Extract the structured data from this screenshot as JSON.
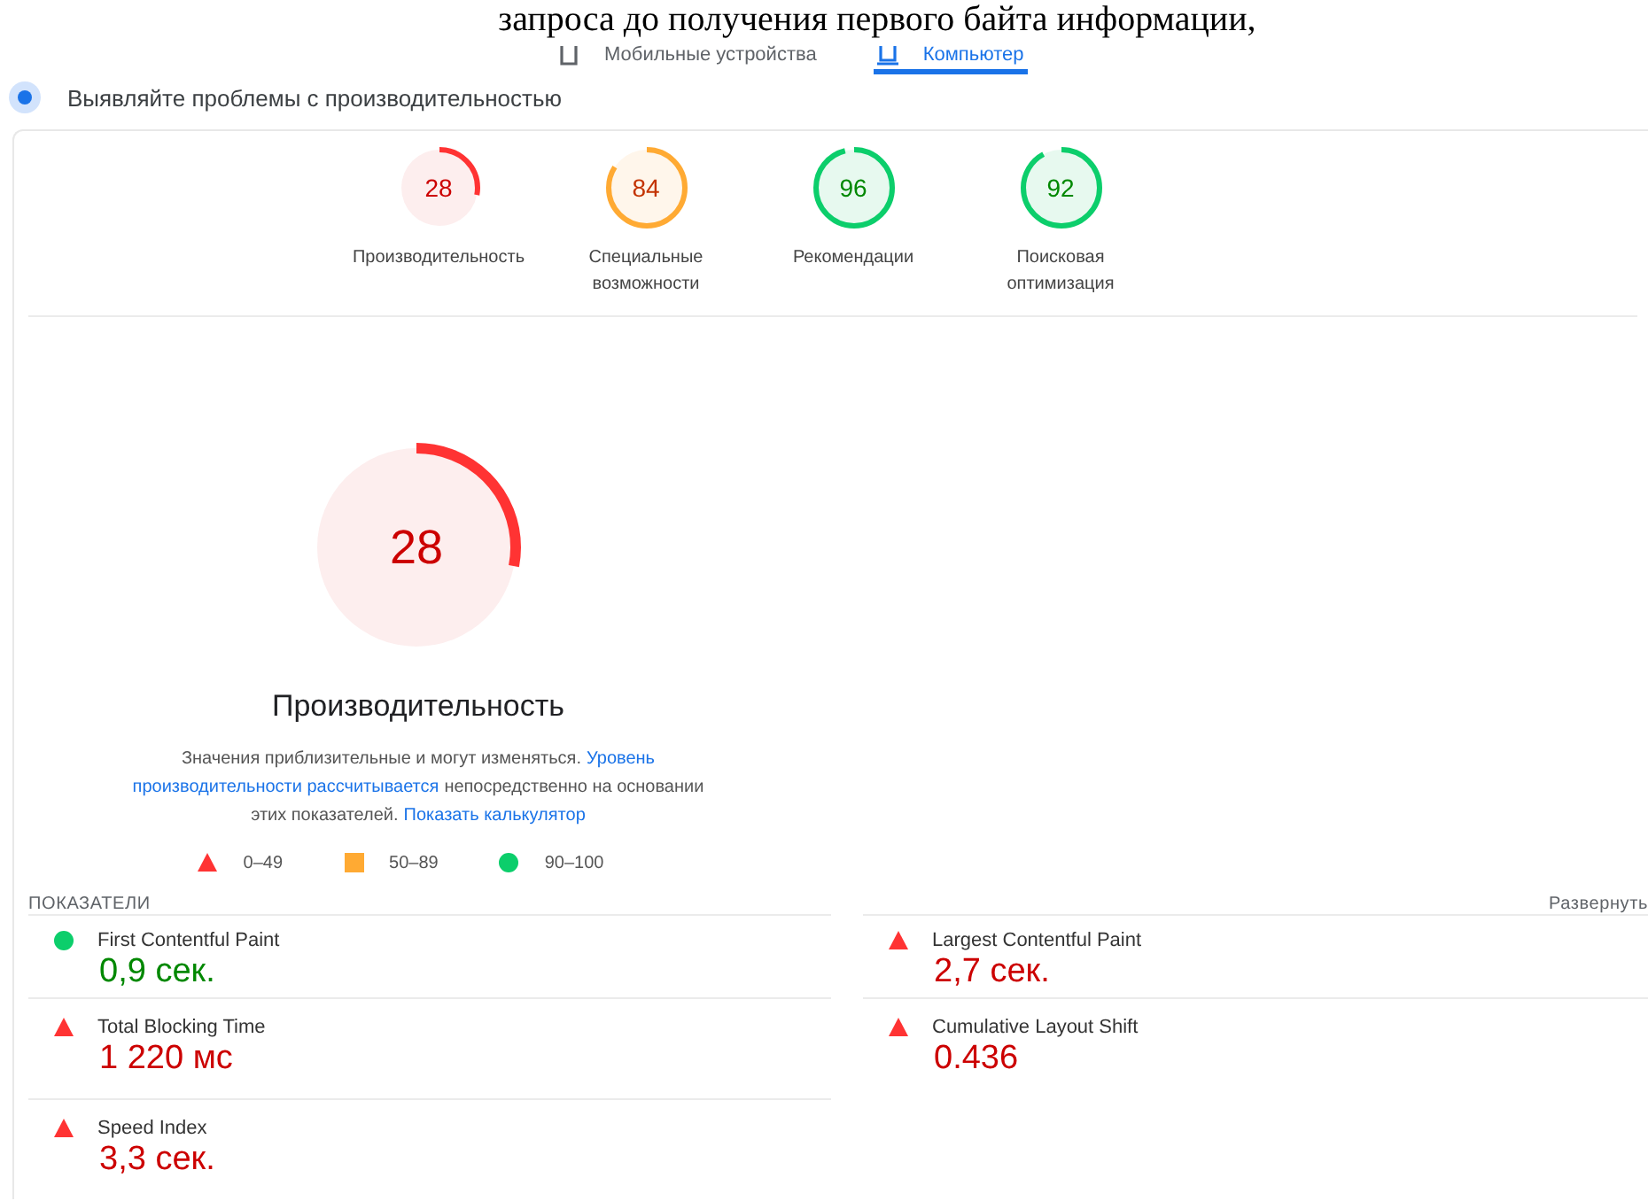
{
  "document_line": "запроса до получения первого байта информации,",
  "tabs": [
    {
      "label": "Мобильные устройства",
      "selected": false
    },
    {
      "label": "Компьютер",
      "selected": true
    }
  ],
  "notice": "Выявляйте проблемы с производительностью",
  "categories": [
    {
      "score": "28",
      "level": 0.28,
      "kind": "fail",
      "label": "Производительность"
    },
    {
      "score": "84",
      "level": 0.84,
      "kind": "average",
      "label": "Специальные возможности"
    },
    {
      "score": "96",
      "level": 0.96,
      "kind": "pass",
      "label": "Рекомендации"
    },
    {
      "score": "92",
      "level": 0.92,
      "kind": "pass",
      "label": "Поисковая оптимизация"
    }
  ],
  "main_score": {
    "score": "28",
    "level": 0.28,
    "kind": "fail",
    "title": "Производительность"
  },
  "description": [
    [
      {
        "kind": "text",
        "text": "Значения приблизительные и могут изменяться."
      },
      {
        "kind": "link",
        "text": "Уровень"
      }
    ],
    [
      {
        "kind": "link",
        "text": "производительности рассчитывается"
      },
      {
        "kind": "text",
        "text": "непосредственно на основании"
      }
    ],
    [
      {
        "kind": "text",
        "text": "этих показателей."
      },
      {
        "kind": "link",
        "text": "Показать калькулятор"
      }
    ]
  ],
  "legend": [
    {
      "kind": "fail",
      "label": "0–49"
    },
    {
      "kind": "average",
      "label": "50–89"
    },
    {
      "kind": "pass",
      "label": "90–100"
    }
  ],
  "metrics_header": "ПОКАЗАТЕЛИ",
  "expand_link": "Развернуть",
  "metrics": [
    {
      "name": "First Contentful Paint",
      "value": "0,9 сек.",
      "kind": "pass"
    },
    {
      "name": "Largest Contentful Paint",
      "value": "2,7 сек.",
      "kind": "fail"
    },
    {
      "name": "Total Blocking Time",
      "value": "1 220 мс",
      "kind": "fail"
    },
    {
      "name": "Cumulative Layout Shift",
      "value": "0.436",
      "kind": "fail"
    },
    {
      "name": "Speed Index",
      "value": "3,3 сек.",
      "kind": "fail"
    }
  ]
}
